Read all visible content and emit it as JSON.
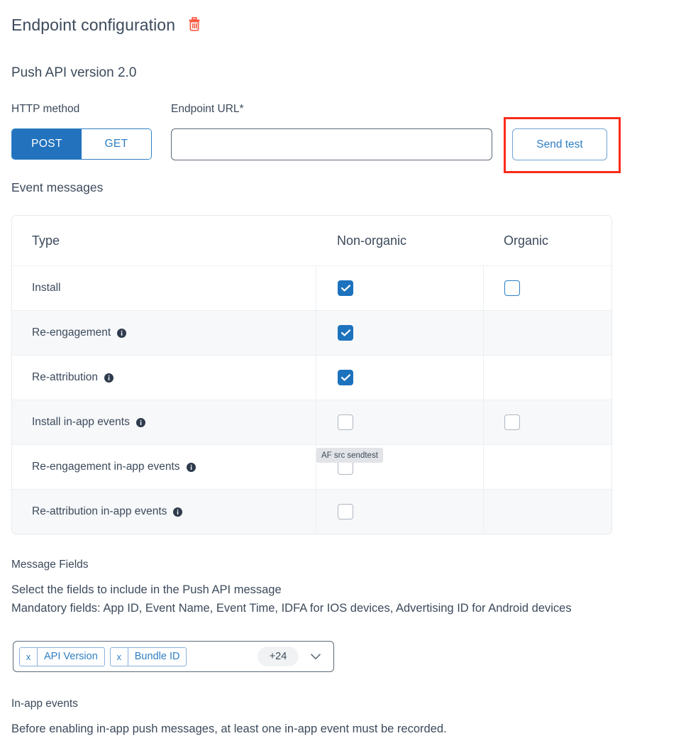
{
  "header": {
    "title": "Endpoint configuration",
    "delete_icon": "trash-icon",
    "subtitle": "Push API version 2.0"
  },
  "form": {
    "http_method_label": "HTTP method",
    "methods": [
      {
        "label": "POST",
        "selected": true
      },
      {
        "label": "GET",
        "selected": false
      }
    ],
    "endpoint_url_label": "Endpoint URL*",
    "endpoint_url_value": "",
    "endpoint_url_placeholder": "",
    "send_test_label": "Send test"
  },
  "event_messages": {
    "section_label": "Event messages",
    "columns": [
      "Type",
      "Non-organic",
      "Organic"
    ],
    "rows": [
      {
        "type": "Install",
        "has_info": false,
        "non_organic": "checked",
        "organic": "unchecked-enabled"
      },
      {
        "type": "Re-engagement",
        "has_info": true,
        "non_organic": "checked",
        "organic": "none"
      },
      {
        "type": "Re-attribution",
        "has_info": true,
        "non_organic": "checked",
        "organic": "none"
      },
      {
        "type": "Install in-app events",
        "has_info": true,
        "non_organic": "unchecked-disabled",
        "organic": "unchecked-disabled"
      },
      {
        "type": "Re-engagement in-app events",
        "has_info": true,
        "non_organic": "unchecked-disabled",
        "organic": "none"
      },
      {
        "type": "Re-attribution in-app events",
        "has_info": true,
        "non_organic": "unchecked-disabled",
        "organic": "none"
      }
    ]
  },
  "tooltip": {
    "text": "AF src sendtest"
  },
  "message_fields": {
    "title": "Message Fields",
    "line1": "Select the fields to include in the Push API message",
    "line2": "Mandatory fields: App ID, Event Name, Event Time, IDFA for IOS devices, Advertising ID for Android devices",
    "chips": [
      {
        "remove": "x",
        "label": "API Version"
      },
      {
        "remove": "x",
        "label": "Bundle ID"
      }
    ],
    "overflow_count": "+24",
    "chevron_icon": "chevron-down-icon"
  },
  "in_app_events": {
    "title": "In-app events",
    "text": "Before enabling in-app push messages, at least one in-app event must be recorded."
  },
  "colors": {
    "accent_blue": "#2272bd",
    "link_blue": "#2f7fc4",
    "highlight_red": "#fb2c1b",
    "trash_orange": "#fb5a43",
    "text": "#3c4a5b",
    "row_alt": "#f7f8fa",
    "border": "#e6e9ec"
  }
}
